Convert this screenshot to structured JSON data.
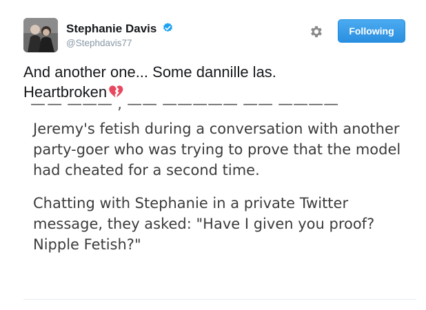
{
  "profile": {
    "display_name": "Stephanie Davis",
    "handle": "@Stephdavis77",
    "verified": true
  },
  "actions": {
    "settings_icon": "gear-icon",
    "follow_label": "Following"
  },
  "tweet": {
    "text_line1": "And another one... Some dannille las.",
    "text_line2": "Heartbroken",
    "emoji": "broken-heart"
  },
  "embedded_article": {
    "paragraphs": [
      "Jeremy's fetish during a conversation with another party-goer who was trying to prove that the model had cheated for a second time.",
      "Chatting with Stephanie in a private Twitter message, they asked: \"Have I given you proof? Nipple Fetish?\""
    ]
  },
  "colors": {
    "accent": "#2b8fe0",
    "handle_gray": "#8899a6",
    "verified_blue": "#1da1f2",
    "heart_pink": "#e8485e"
  }
}
